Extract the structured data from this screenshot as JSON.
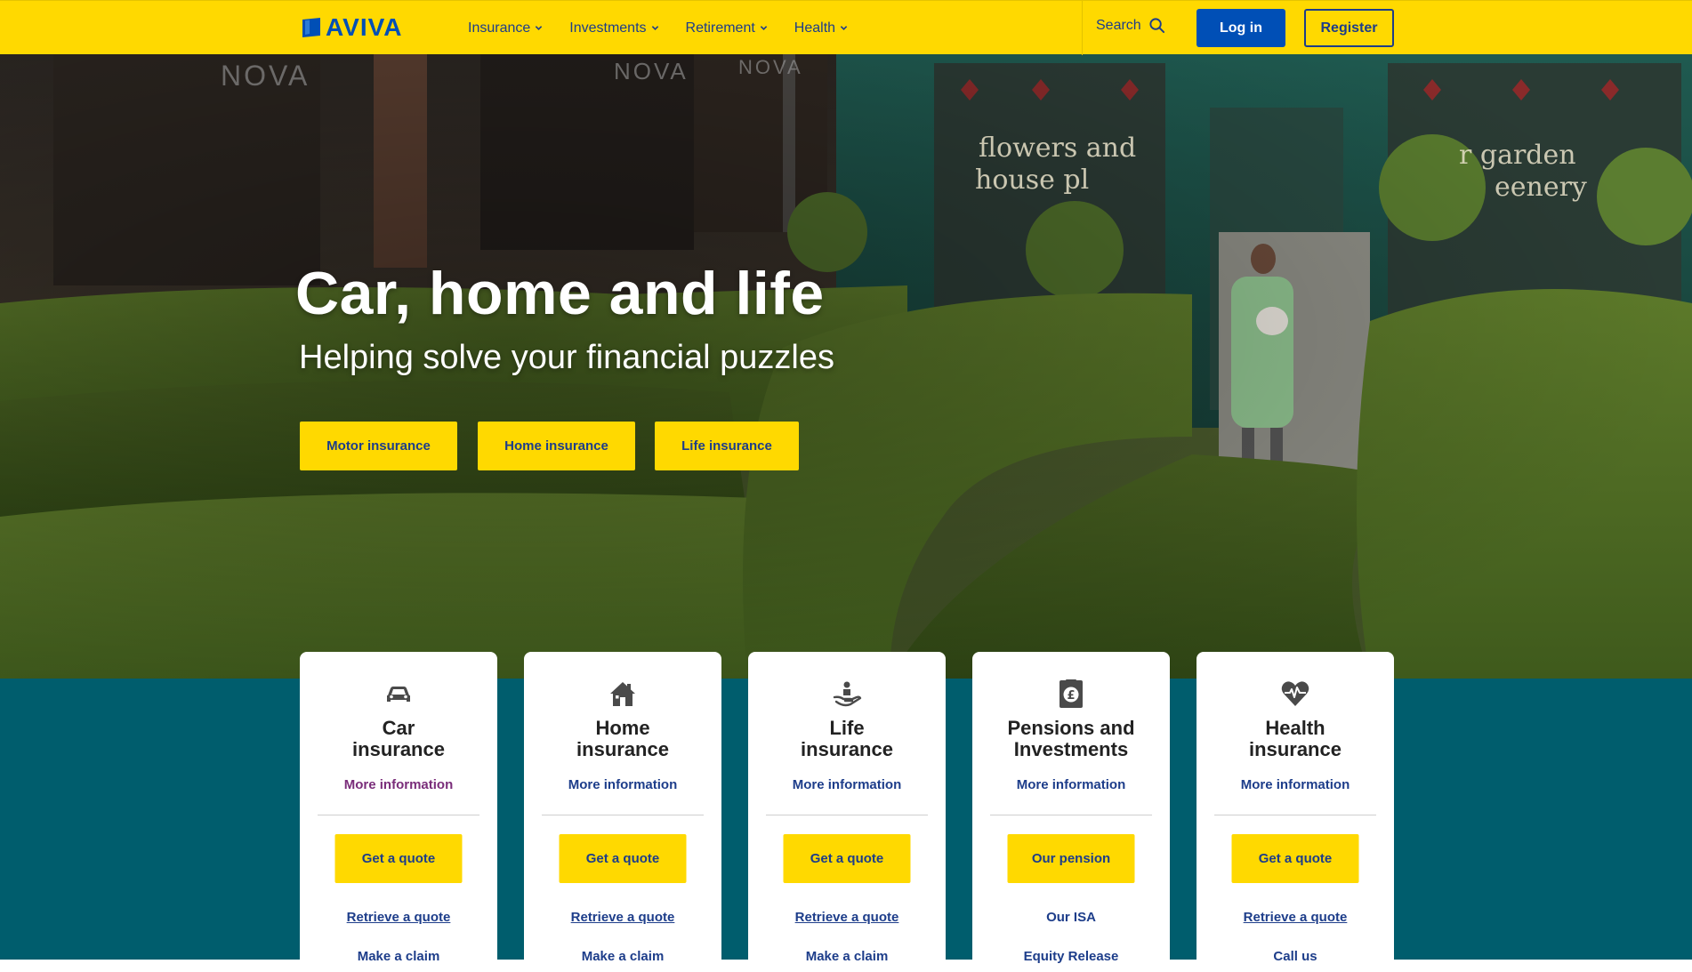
{
  "header": {
    "logo_text": "AVIVA",
    "nav": [
      {
        "label": "Insurance"
      },
      {
        "label": "Investments"
      },
      {
        "label": "Retirement"
      },
      {
        "label": "Health"
      }
    ],
    "search_label": "Search",
    "login_label": "Log in",
    "register_label": "Register"
  },
  "hero": {
    "title": "Car, home and life",
    "subtitle": "Helping solve your financial puzzles",
    "buttons": [
      {
        "label": "Motor insurance"
      },
      {
        "label": "Home insurance"
      },
      {
        "label": "Life insurance"
      }
    ],
    "shop_signs": [
      "NOVA",
      "NOVA",
      "NOVA",
      "flowers and",
      "house pl",
      "r garden",
      "eenery"
    ]
  },
  "cards": [
    {
      "icon": "car-icon",
      "title_line1": "Car",
      "title_line2": "insurance",
      "more": "More information",
      "primary": "Get a quote",
      "link1": "Retrieve a quote",
      "link2": "Make a claim"
    },
    {
      "icon": "house-icon",
      "title_line1": "Home",
      "title_line2": "insurance",
      "more": "More information",
      "primary": "Get a quote",
      "link1": "Retrieve a quote",
      "link2": "Make a claim"
    },
    {
      "icon": "hand-person-icon",
      "title_line1": "Life",
      "title_line2": "insurance",
      "more": "More information",
      "primary": "Get a quote",
      "link1": "Retrieve a quote",
      "link2": "Make a claim"
    },
    {
      "icon": "pound-document-icon",
      "title_line1": "Pensions and",
      "title_line2": "Investments",
      "more": "More information",
      "primary": "Our pension",
      "link1": "Our ISA",
      "link2": "Equity Release"
    },
    {
      "icon": "heart-pulse-icon",
      "title_line1": "Health",
      "title_line2": "insurance",
      "more": "More information",
      "primary": "Get a quote",
      "link1": "Retrieve a quote",
      "link2": "Call us"
    }
  ],
  "colors": {
    "brand_yellow": "#ffd900",
    "brand_blue": "#004fb6",
    "link_navy": "#1d3d8a",
    "teal": "#005d6d",
    "visited_purple": "#7a2d7a"
  }
}
